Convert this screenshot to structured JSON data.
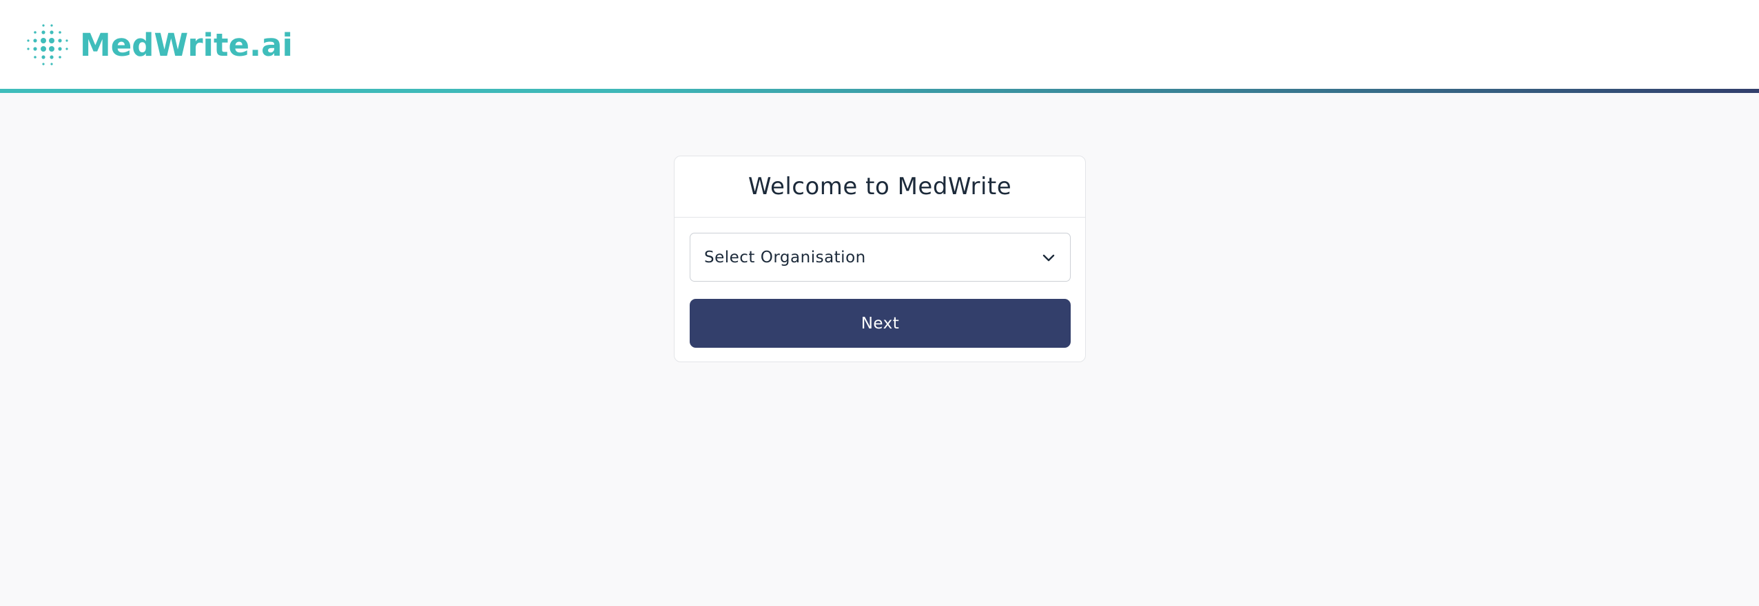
{
  "header": {
    "logo_text": "MedWrite.ai",
    "logo_icon": "dotted-sphere-icon",
    "brand_color": "#3fbdbb",
    "accent_gradient": [
      "#3fbdbb",
      "#323f6c"
    ]
  },
  "card": {
    "title": "Welcome to MedWrite",
    "organisation_select": {
      "value": "Select Organisation",
      "icon": "chevron-down-icon"
    },
    "next_label": "Next",
    "button_color": "#333f6b"
  }
}
